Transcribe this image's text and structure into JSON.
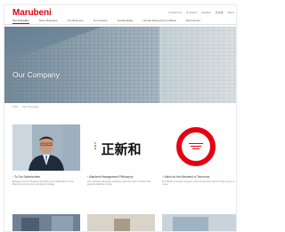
{
  "header": {
    "logo": "Marubeni",
    "util_links": [
      "Contact Us",
      "Q Search",
      "English",
      "日本語",
      "Menu"
    ]
  },
  "nav": {
    "items": [
      {
        "label": "Our Company",
        "active": true
      },
      {
        "label": "News Releases",
        "active": false
      },
      {
        "label": "Our Business",
        "active": false
      },
      {
        "label": "To Investors",
        "active": false
      },
      {
        "label": "Sustainability",
        "active": false
      },
      {
        "label": "Human Resources & Values",
        "active": false
      },
      {
        "label": "Recruitment",
        "active": false
      }
    ]
  },
  "hero": {
    "title": "Our Company"
  },
  "breadcrumb": {
    "home": "TOP",
    "sep": "›",
    "current": "Our Company"
  },
  "cards": [
    {
      "title": "To Our Stakeholders",
      "desc": "Message from the President and CEO to our stakeholders on the Marubeni Group's vision and growth strategy."
    },
    {
      "title": "Marubeni Management Philosophy",
      "desc": "Our corporate philosophy, company motto and code of conduct that guide the Marubeni Group."
    },
    {
      "title": "Vision for the Marubeni of Tomorrow",
      "desc": "The Marubeni Group's long-term vision for the future and the value we aim to create."
    }
  ],
  "calligraphy": "正新和",
  "colors": {
    "brand_red": "#e60012"
  }
}
